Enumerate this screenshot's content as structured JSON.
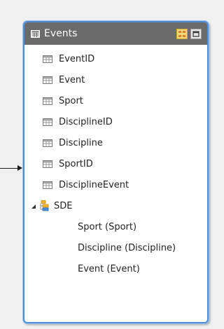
{
  "table": {
    "title": "Events",
    "fields": [
      "EventID",
      "Event",
      "Sport",
      "DisciplineID",
      "Discipline",
      "SportID",
      "DisciplineEvent"
    ],
    "hierarchy": {
      "name": "SDE",
      "levels": [
        "Sport (Sport)",
        "Discipline (Discipline)",
        "Event (Event)"
      ]
    }
  },
  "icons": {
    "header": "table-icon",
    "field": "column-icon",
    "hierarchy": "hierarchy-icon",
    "toggle": "expanded-triangle-icon",
    "diagram_button": "diagram-view-icon",
    "restore_button": "restore-icon"
  },
  "colors": {
    "header_bg": "#6b6b6b",
    "border_accent": "#4f8fd6",
    "canvas_bg": "#f0f0f0"
  }
}
